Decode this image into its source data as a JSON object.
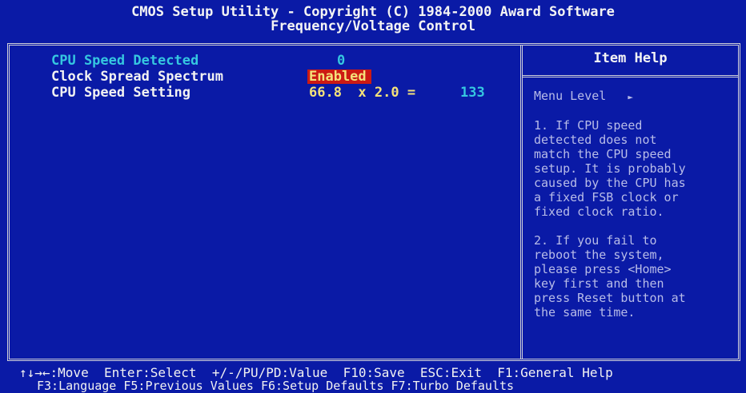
{
  "header": {
    "line1": "CMOS Setup Utility - Copyright (C) 1984-2000 Award Software",
    "line2": "Frequency/Voltage Control"
  },
  "settings": [
    {
      "label": "CPU Speed Detected",
      "value": "0",
      "state": "disabled"
    },
    {
      "label": "Clock Spread Spectrum",
      "value": "Enabled",
      "state": "selected"
    },
    {
      "label": "CPU Speed Setting",
      "value": "66.8  x 2.0 =",
      "extra": "133",
      "state": "normal"
    }
  ],
  "help": {
    "title": "Item Help",
    "menu_level_label": "Menu Level",
    "menu_level_arrow": "►",
    "text": "1. If CPU speed\ndetected does not\nmatch the CPU speed\nsetup. It is probably\ncaused by the CPU has\na fixed FSB clock or\nfixed clock ratio.\n\n2. If you fail to\nreboot the system,\nplease press <Home>\nkey first and then\npress Reset button at\nthe same time."
  },
  "footer": {
    "line1": "↑↓→←:Move  Enter:Select  +/-/PU/PD:Value  F10:Save  ESC:Exit  F1:General Help",
    "line2": "F3:Language F5:Previous Values F6:Setup Defaults F7:Turbo Defaults"
  },
  "colors": {
    "background": "#0a1aa6",
    "highlight": "#cc1a14",
    "value": "#f4e27a",
    "disabled": "#35c7e0"
  }
}
